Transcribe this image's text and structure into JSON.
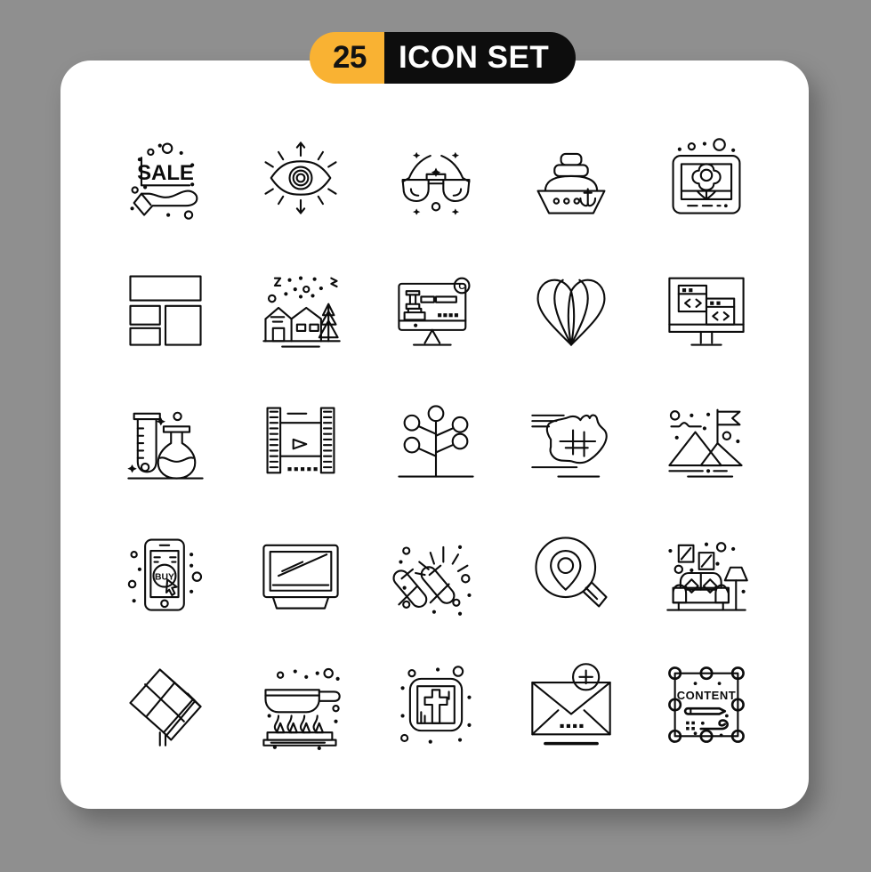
{
  "background_color": "#8f8f8f",
  "card": {
    "background_color": "#ffffff"
  },
  "badge": {
    "count": "25",
    "label": "ICON SET",
    "count_bg": "#f9b233",
    "label_bg": "#0d0d0d",
    "count_color": "#121212",
    "label_color": "#ffffff"
  },
  "icons": [
    {
      "name": "sale-hand-icon",
      "label": "SALE",
      "row": 1,
      "col": 1
    },
    {
      "name": "eye-vision-icon",
      "label": "",
      "row": 1,
      "col": 2
    },
    {
      "name": "sunglasses-icon",
      "label": "",
      "row": 1,
      "col": 3
    },
    {
      "name": "cruise-ship-icon",
      "label": "",
      "row": 1,
      "col": 4
    },
    {
      "name": "flower-picture-icon",
      "label": "",
      "row": 1,
      "col": 5
    },
    {
      "name": "layout-grid-icon",
      "label": "",
      "row": 2,
      "col": 1
    },
    {
      "name": "snow-house-icon",
      "label": "",
      "row": 2,
      "col": 2
    },
    {
      "name": "copyright-monitor-icon",
      "label": "",
      "row": 2,
      "col": 3
    },
    {
      "name": "heart-balloon-icon",
      "label": "",
      "row": 2,
      "col": 4
    },
    {
      "name": "code-windows-icon",
      "label": "",
      "row": 2,
      "col": 5
    },
    {
      "name": "lab-flask-icon",
      "label": "",
      "row": 3,
      "col": 1
    },
    {
      "name": "film-strip-play-icon",
      "label": "",
      "row": 3,
      "col": 2
    },
    {
      "name": "network-tree-icon",
      "label": "",
      "row": 3,
      "col": 3
    },
    {
      "name": "australia-map-icon",
      "label": "",
      "row": 3,
      "col": 4
    },
    {
      "name": "mountain-flag-icon",
      "label": "",
      "row": 3,
      "col": 5
    },
    {
      "name": "mobile-buy-icon",
      "label": "BUY",
      "row": 4,
      "col": 1
    },
    {
      "name": "desktop-monitor-icon",
      "label": "",
      "row": 4,
      "col": 2
    },
    {
      "name": "sparklers-icon",
      "label": "",
      "row": 4,
      "col": 3
    },
    {
      "name": "location-search-icon",
      "label": "",
      "row": 4,
      "col": 4
    },
    {
      "name": "living-room-sofa-icon",
      "label": "",
      "row": 4,
      "col": 5
    },
    {
      "name": "solar-panel-icon",
      "label": "",
      "row": 5,
      "col": 1
    },
    {
      "name": "frying-pan-stove-icon",
      "label": "",
      "row": 5,
      "col": 2
    },
    {
      "name": "church-bible-icon",
      "label": "",
      "row": 5,
      "col": 3
    },
    {
      "name": "add-mail-icon",
      "label": "",
      "row": 5,
      "col": 4
    },
    {
      "name": "content-board-icon",
      "label": "CONTENT",
      "row": 5,
      "col": 5
    }
  ]
}
